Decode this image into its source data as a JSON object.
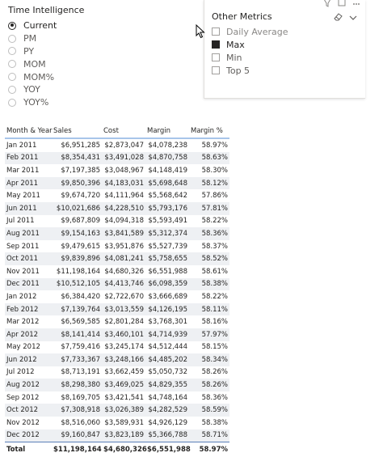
{
  "time_slicer": {
    "title": "Time Intelligence",
    "options": [
      "Current",
      "PM",
      "PY",
      "MOM",
      "MOM%",
      "YOY",
      "YOY%"
    ],
    "selected": "Current"
  },
  "metrics_slicer": {
    "title": "Other Metrics",
    "icons": [
      "eraser-icon",
      "chevron-down-icon",
      "filter-icon",
      "focus-mode-icon",
      "more-options-icon"
    ],
    "options": [
      {
        "label": "Daily Average",
        "checked": false
      },
      {
        "label": "Max",
        "checked": true
      },
      {
        "label": "Min",
        "checked": false
      },
      {
        "label": "Top 5",
        "checked": false
      }
    ]
  },
  "table": {
    "columns": [
      "Month & Year",
      "Sales",
      "Cost",
      "Margin",
      "Margin %"
    ],
    "rows": [
      [
        "Jan 2011",
        "$6,951,285",
        "$2,873,047",
        "$4,078,238",
        "58.97%"
      ],
      [
        "Feb 2011",
        "$8,354,431",
        "$3,491,028",
        "$4,870,758",
        "58.63%"
      ],
      [
        "Mar 2011",
        "$7,197,385",
        "$3,048,967",
        "$4,148,419",
        "58.30%"
      ],
      [
        "Apr 2011",
        "$9,850,396",
        "$4,183,031",
        "$5,698,648",
        "58.12%"
      ],
      [
        "May 2011",
        "$9,674,720",
        "$4,111,964",
        "$5,568,642",
        "57.86%"
      ],
      [
        "Jun 2011",
        "$10,021,686",
        "$4,228,510",
        "$5,793,176",
        "57.81%"
      ],
      [
        "Jul 2011",
        "$9,687,809",
        "$4,094,318",
        "$5,593,491",
        "58.22%"
      ],
      [
        "Aug 2011",
        "$9,154,163",
        "$3,841,589",
        "$5,312,374",
        "58.36%"
      ],
      [
        "Sep 2011",
        "$9,479,615",
        "$3,951,876",
        "$5,527,739",
        "58.37%"
      ],
      [
        "Oct 2011",
        "$9,839,896",
        "$4,081,241",
        "$5,758,655",
        "58.52%"
      ],
      [
        "Nov 2011",
        "$11,198,164",
        "$4,680,326",
        "$6,551,988",
        "58.61%"
      ],
      [
        "Dec 2011",
        "$10,512,105",
        "$4,413,746",
        "$6,098,359",
        "58.38%"
      ],
      [
        "Jan 2012",
        "$6,384,420",
        "$2,722,670",
        "$3,666,689",
        "58.22%"
      ],
      [
        "Feb 2012",
        "$7,139,764",
        "$3,013,559",
        "$4,126,195",
        "58.11%"
      ],
      [
        "Mar 2012",
        "$6,569,585",
        "$2,801,284",
        "$3,768,301",
        "58.16%"
      ],
      [
        "Apr 2012",
        "$8,141,414",
        "$3,460,101",
        "$4,714,939",
        "57.97%"
      ],
      [
        "May 2012",
        "$7,759,416",
        "$3,245,174",
        "$4,512,444",
        "58.15%"
      ],
      [
        "Jun 2012",
        "$7,733,367",
        "$3,248,166",
        "$4,485,202",
        "58.34%"
      ],
      [
        "Jul 2012",
        "$8,713,191",
        "$3,662,459",
        "$5,050,732",
        "58.26%"
      ],
      [
        "Aug 2012",
        "$8,298,380",
        "$3,469,025",
        "$4,829,355",
        "58.26%"
      ],
      [
        "Sep 2012",
        "$8,169,705",
        "$3,421,541",
        "$4,748,164",
        "58.36%"
      ],
      [
        "Oct 2012",
        "$7,308,918",
        "$3,026,389",
        "$4,282,529",
        "58.59%"
      ],
      [
        "Nov 2012",
        "$8,516,060",
        "$3,589,931",
        "$4,926,129",
        "58.38%"
      ],
      [
        "Dec 2012",
        "$9,160,847",
        "$3,823,189",
        "$5,366,788",
        "58.71%"
      ]
    ],
    "total": [
      "Total",
      "$11,198,164",
      "$4,680,326",
      "$6,551,988",
      "58.97%"
    ]
  },
  "colors": {
    "header_border": "#a8c5ea",
    "row_band": "#eef0f3",
    "total_border": "#5b7fb8"
  }
}
